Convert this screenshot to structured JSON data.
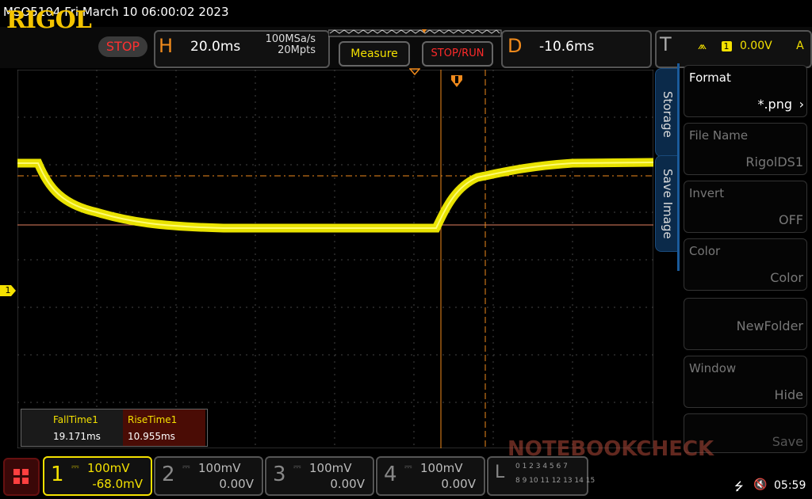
{
  "title_bar": {
    "text": "MSO5104  Fri March 10 06:00:02 2023"
  },
  "toolbar": {
    "logo": "RIGOL",
    "run_state": "STOP",
    "horizontal": {
      "letter": "H",
      "timebase": "20.0ms",
      "sample_rate": "100MSa/s",
      "memory_depth": "20Mpts"
    },
    "measure_label": "Measure",
    "stop_run_label": "STOP/RUN",
    "delay": {
      "letter": "D",
      "value": "-10.6ms"
    },
    "trigger": {
      "letter": "T",
      "channel": "1",
      "level": "0.00V",
      "coupling": "A"
    }
  },
  "side_menu": {
    "tabs": [
      "Storage",
      "Save Image"
    ],
    "items": [
      {
        "label": "Format",
        "value": "*.png"
      },
      {
        "label": "File Name",
        "value": "RigolDS1"
      },
      {
        "label": "Invert",
        "value": "OFF"
      },
      {
        "label": "Color",
        "value": "Color"
      },
      {
        "label": "",
        "value": "NewFolder"
      },
      {
        "label": "Window",
        "value": "Hide"
      },
      {
        "label": "",
        "value": "Save"
      }
    ]
  },
  "measurements": {
    "headers": [
      "FallTime1",
      "RiseTime1"
    ],
    "values": [
      "19.171ms",
      "10.955ms"
    ]
  },
  "channel_marker": "1",
  "channels": [
    {
      "num": "1",
      "scale": "100mV",
      "offset": "-68.0mV",
      "active": true
    },
    {
      "num": "2",
      "scale": "100mV",
      "offset": "0.00V",
      "active": false
    },
    {
      "num": "3",
      "scale": "100mV",
      "offset": "0.00V",
      "active": false
    },
    {
      "num": "4",
      "scale": "100mV",
      "offset": "0.00V",
      "active": false
    }
  ],
  "logic": {
    "letter": "L",
    "row1": "0 1 2 3 4 5 6 7",
    "row2": "8 9 10 11 12 13 14 15"
  },
  "status": {
    "time": "05:59"
  },
  "watermark": "NOTEBOOKCHECK",
  "colors": {
    "trace": "#f4ee00",
    "cursor": "#f08a1c",
    "stop": "#ff2a2a"
  }
}
